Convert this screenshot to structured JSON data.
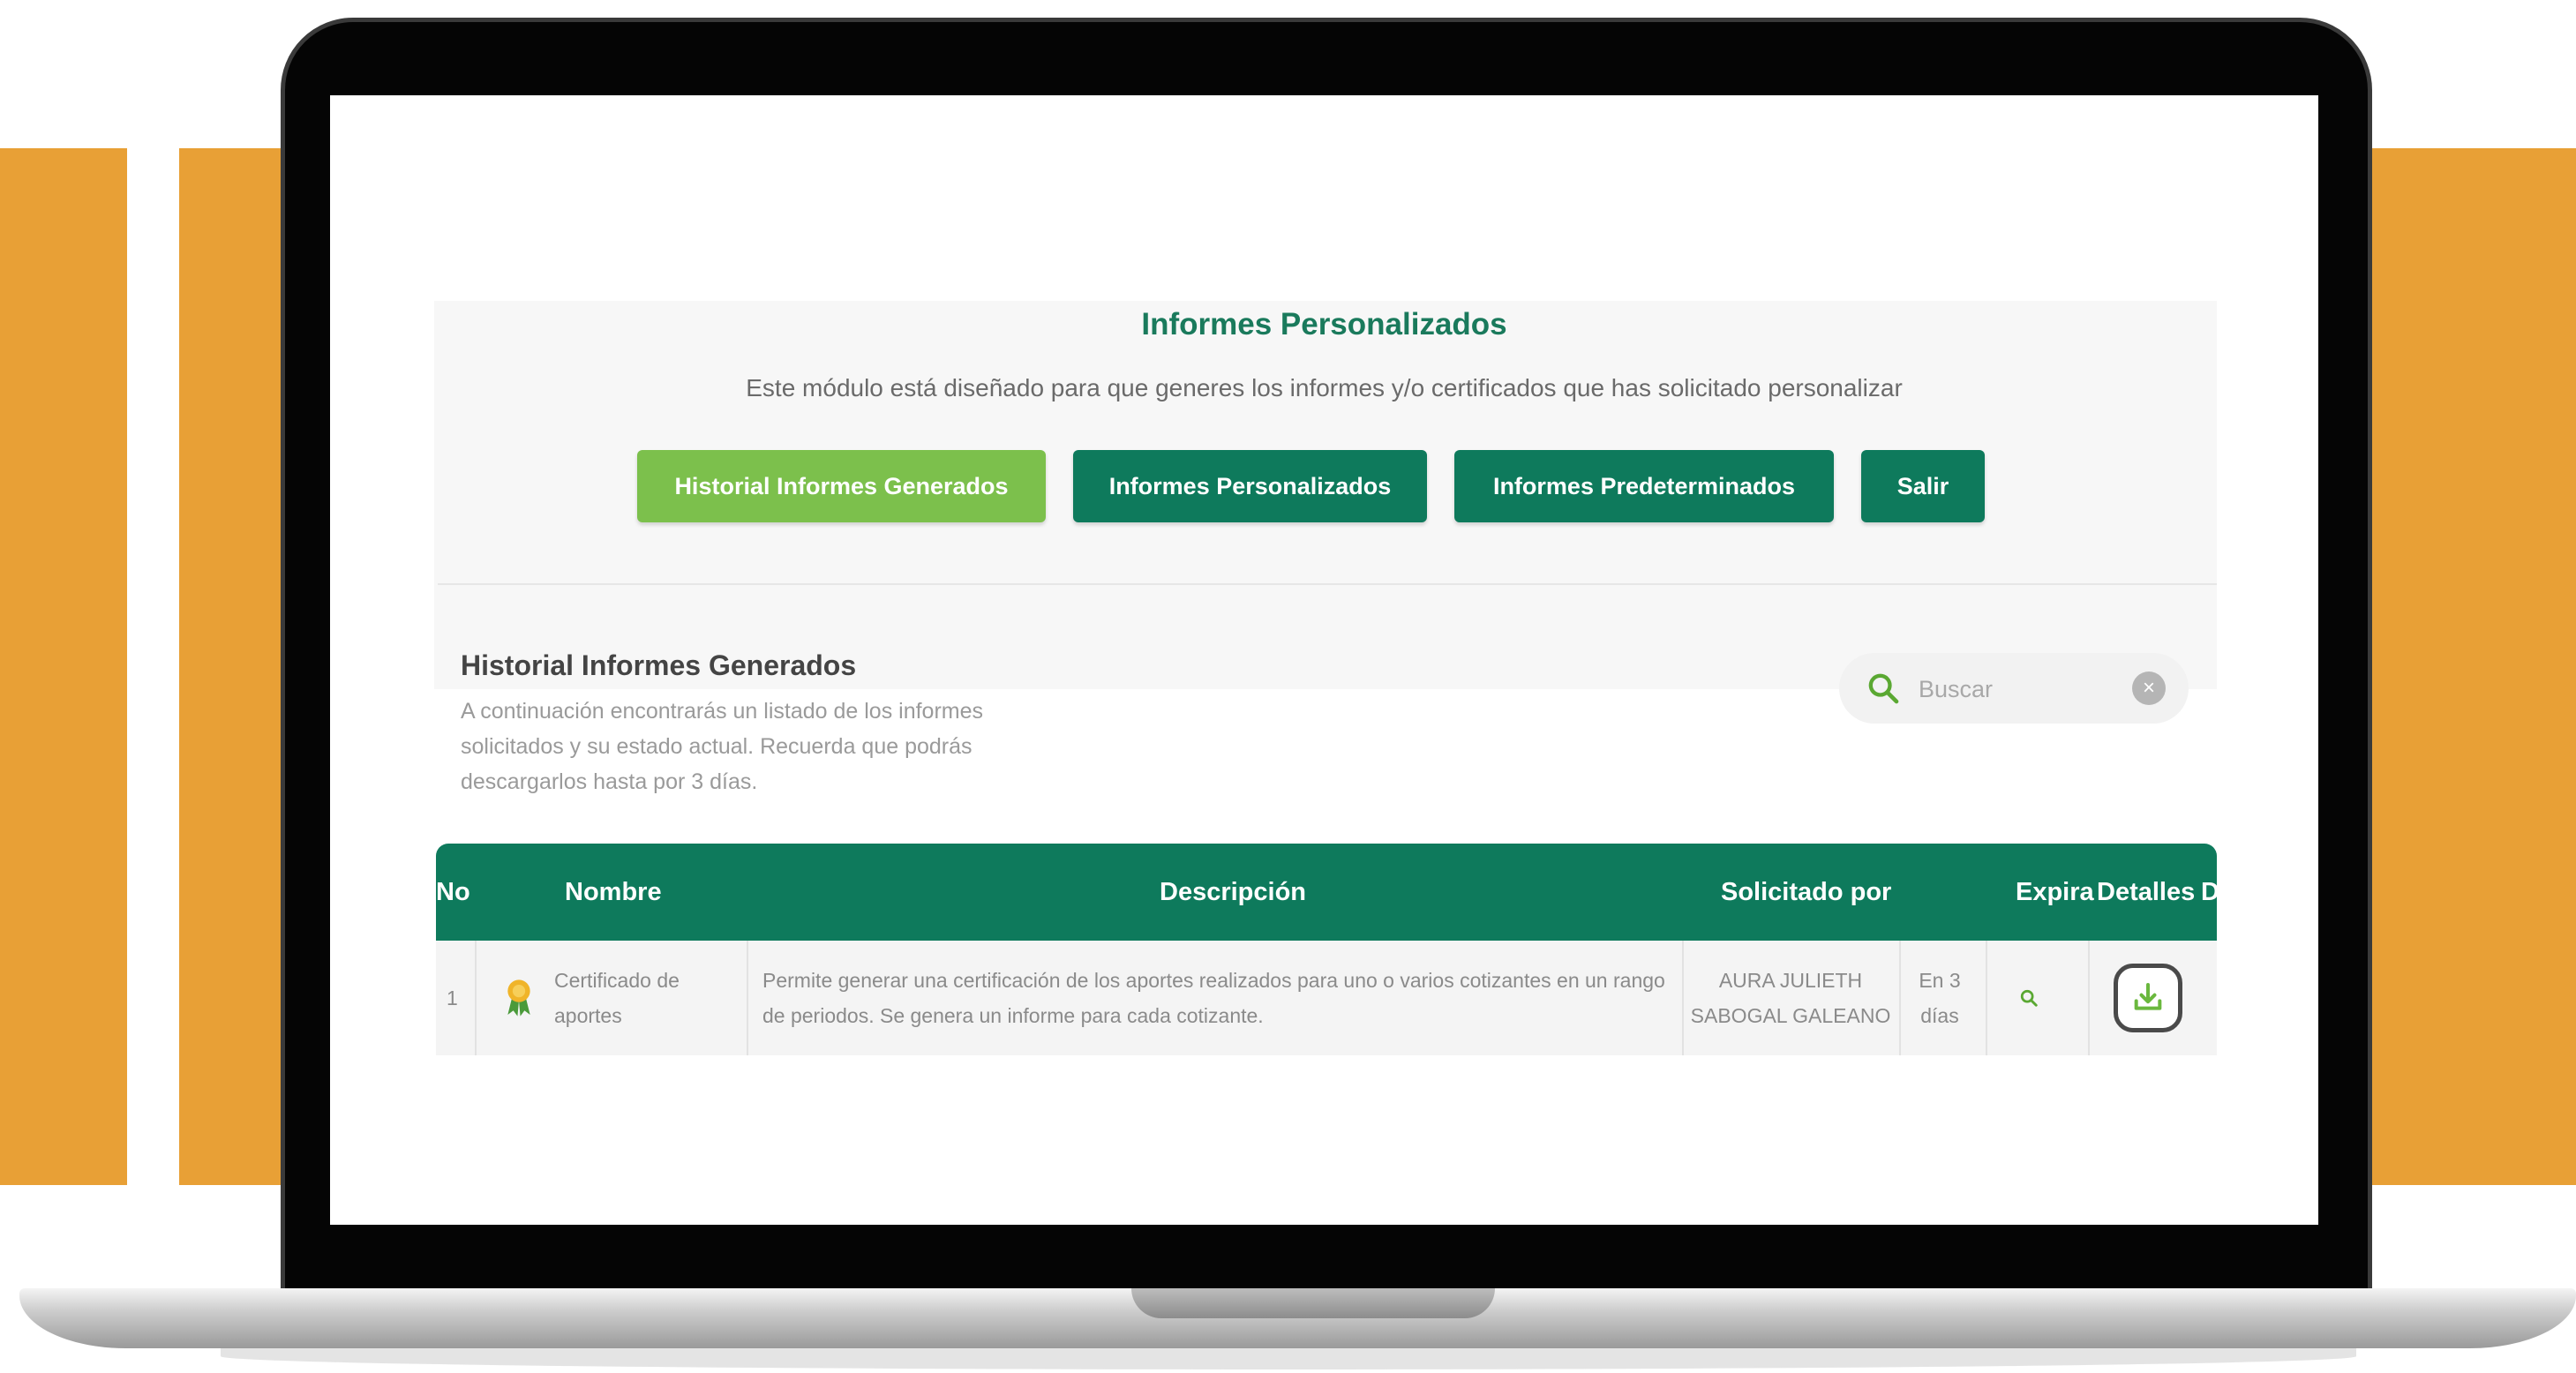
{
  "colors": {
    "accent_orange": "#e8a036",
    "primary_green": "#0e7a5c",
    "active_green": "#7cc04c"
  },
  "page": {
    "title": "Informes Personalizados",
    "subtitle": "Este módulo está diseñado para que generes los informes y/o certificados que has solicitado personalizar"
  },
  "nav": {
    "historial": "Historial Informes Generados",
    "personalizados": "Informes Personalizados",
    "predeterminados": "Informes Predeterminados",
    "salir": "Salir",
    "active": "historial"
  },
  "section": {
    "title": "Historial Informes Generados",
    "description": "A continuación encontrarás un listado de los informes solicitados y su estado actual. Recuerda que podrás descargarlos hasta por 3 días."
  },
  "search": {
    "placeholder": "Buscar",
    "icon": "search-icon",
    "clear_icon": "clear-icon"
  },
  "table": {
    "headers": {
      "no": "No",
      "nombre": "Nombre",
      "descripcion": "Descripción",
      "solicitado": "Solicitado por",
      "expira": "Expira",
      "detalles": "Detalles",
      "descargar": "Descargar"
    },
    "rows": [
      {
        "no": "1",
        "icon": "award-ribbon-icon",
        "nombre": "Certificado de aportes",
        "descripcion": "Permite generar una certificación de los aportes realizados para uno o varios cotizantes en un rango de periodos. Se genera un informe para cada cotizante.",
        "solicitado": "AURA JULIETH SABOGAL GALEANO",
        "expira": "En 3 días",
        "detalles_icon": "search-icon",
        "descargar_icon": "download-icon"
      }
    ]
  }
}
